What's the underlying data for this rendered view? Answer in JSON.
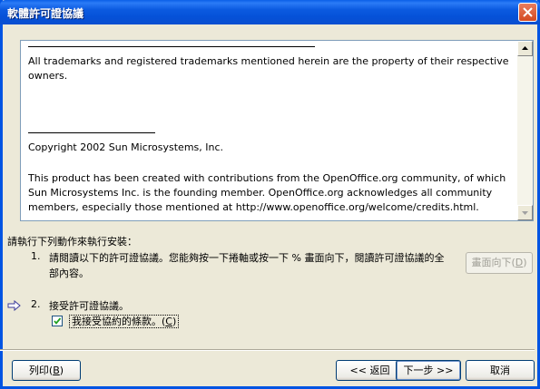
{
  "window": {
    "title": "軟體許可證協議"
  },
  "license": {
    "para1": "All trademarks and registered trademarks mentioned herein are the property of their respective owners.",
    "para2": "Copyright 2002 Sun Microsystems, Inc.",
    "para3": "This product has been created with contributions from the OpenOffice.org community, of which Sun Microsystems Inc. is the founding member. OpenOffice.org acknowledges all community members, especially those mentioned at http://www.openoffice.org/welcome/credits.html."
  },
  "instructions": {
    "heading": "請執行下列動作來執行安裝：",
    "step1_num": "1.",
    "step1_text": "請閱讀以下的許可證協議。您能夠按一下捲軸或按一下 % 畫面向下，閱讀許可證協議的全部內容。",
    "page_down_label": "畫面向下(",
    "page_down_key": "D",
    "page_down_suffix": ")",
    "step2_num": "2.",
    "step2_text": "接受許可證協議。",
    "accept_label": "我接受協約的條款。(",
    "accept_key": "C",
    "accept_suffix": ")",
    "accept_checked": true
  },
  "buttons": {
    "print_label": "列印(",
    "print_key": "B",
    "print_suffix": ")",
    "back_label": "<< 返回",
    "next_label": "下一步 >>",
    "cancel_label": "取消"
  },
  "colors": {
    "titlebar": "#0054e3",
    "dialog_bg": "#ece9d8",
    "disabled_text": "#a09f96"
  }
}
